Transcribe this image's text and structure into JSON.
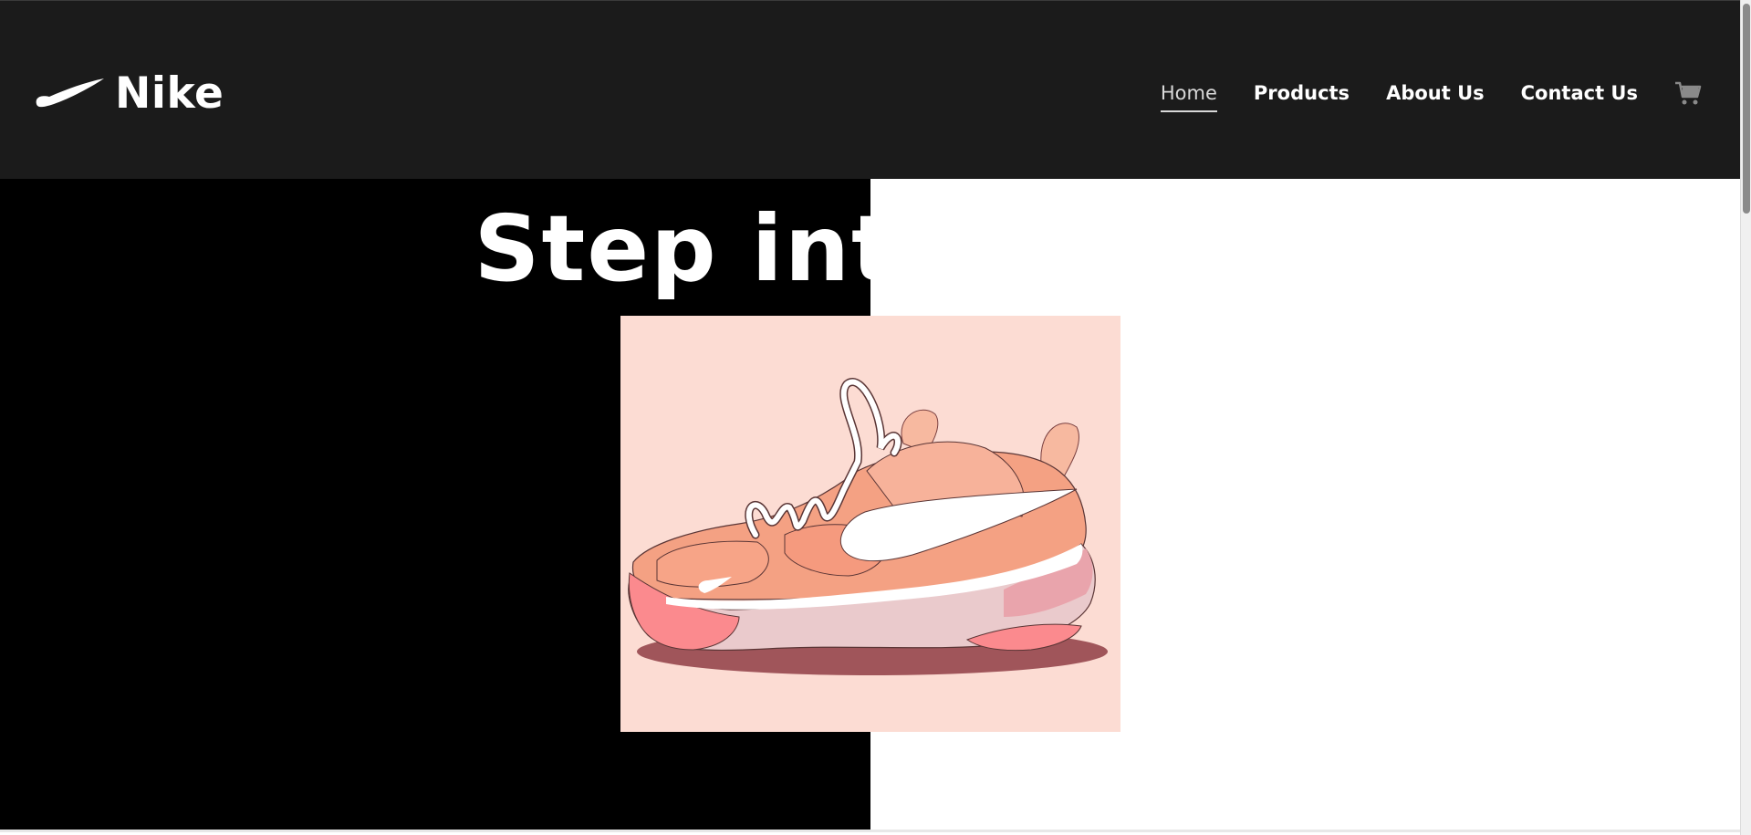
{
  "header": {
    "brand_name": "Nike",
    "logo_icon": "nike-swoosh-icon",
    "nav": [
      {
        "label": "Home",
        "active": true
      },
      {
        "label": "Products",
        "active": false
      },
      {
        "label": "About Us",
        "active": false
      },
      {
        "label": "Contact Us",
        "active": false
      }
    ],
    "cart_icon": "shopping-cart-icon"
  },
  "hero": {
    "title": "Step into Style",
    "image": "pink-sneaker-illustration"
  },
  "colors": {
    "navbar_bg": "#1b1b1b",
    "hero_left_bg": "#000000",
    "hero_right_bg": "#ffffff",
    "image_bg": "#fcdcd3"
  }
}
